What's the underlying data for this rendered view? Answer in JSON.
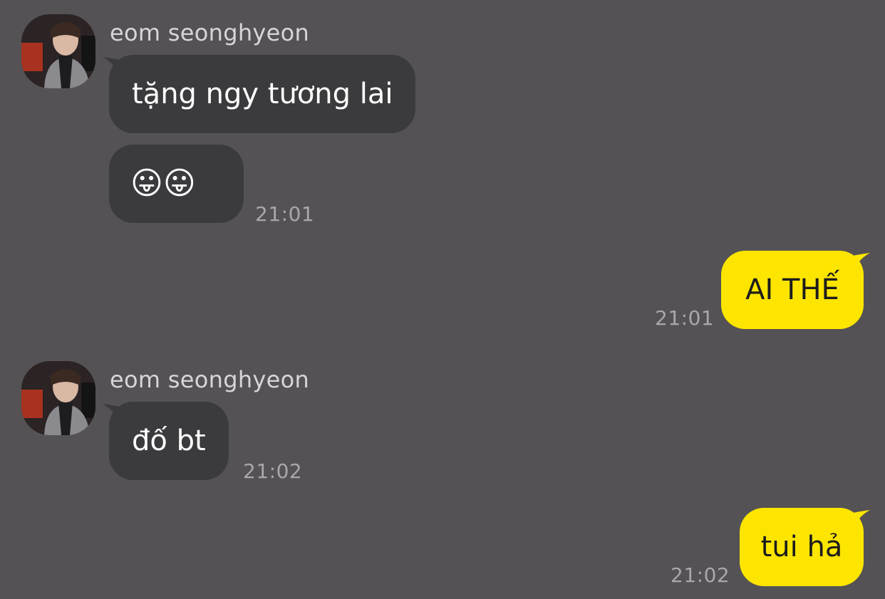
{
  "colors": {
    "background": "#545254",
    "incoming_bubble": "#3b3a3d",
    "outgoing_bubble": "#fee500",
    "timestamp": "#a9a7aa"
  },
  "messages": [
    {
      "sender": "eom seonghyeon",
      "bubbles": [
        "tặng ngy tương lai",
        "😛😛"
      ],
      "time": "21:01"
    },
    {
      "outgoing": true,
      "text": "AI THẾ",
      "time": "21:01"
    },
    {
      "sender": "eom seonghyeon",
      "bubbles": [
        "đố bt"
      ],
      "time": "21:02"
    },
    {
      "outgoing": true,
      "text": "tui hả",
      "time": "21:02"
    }
  ]
}
